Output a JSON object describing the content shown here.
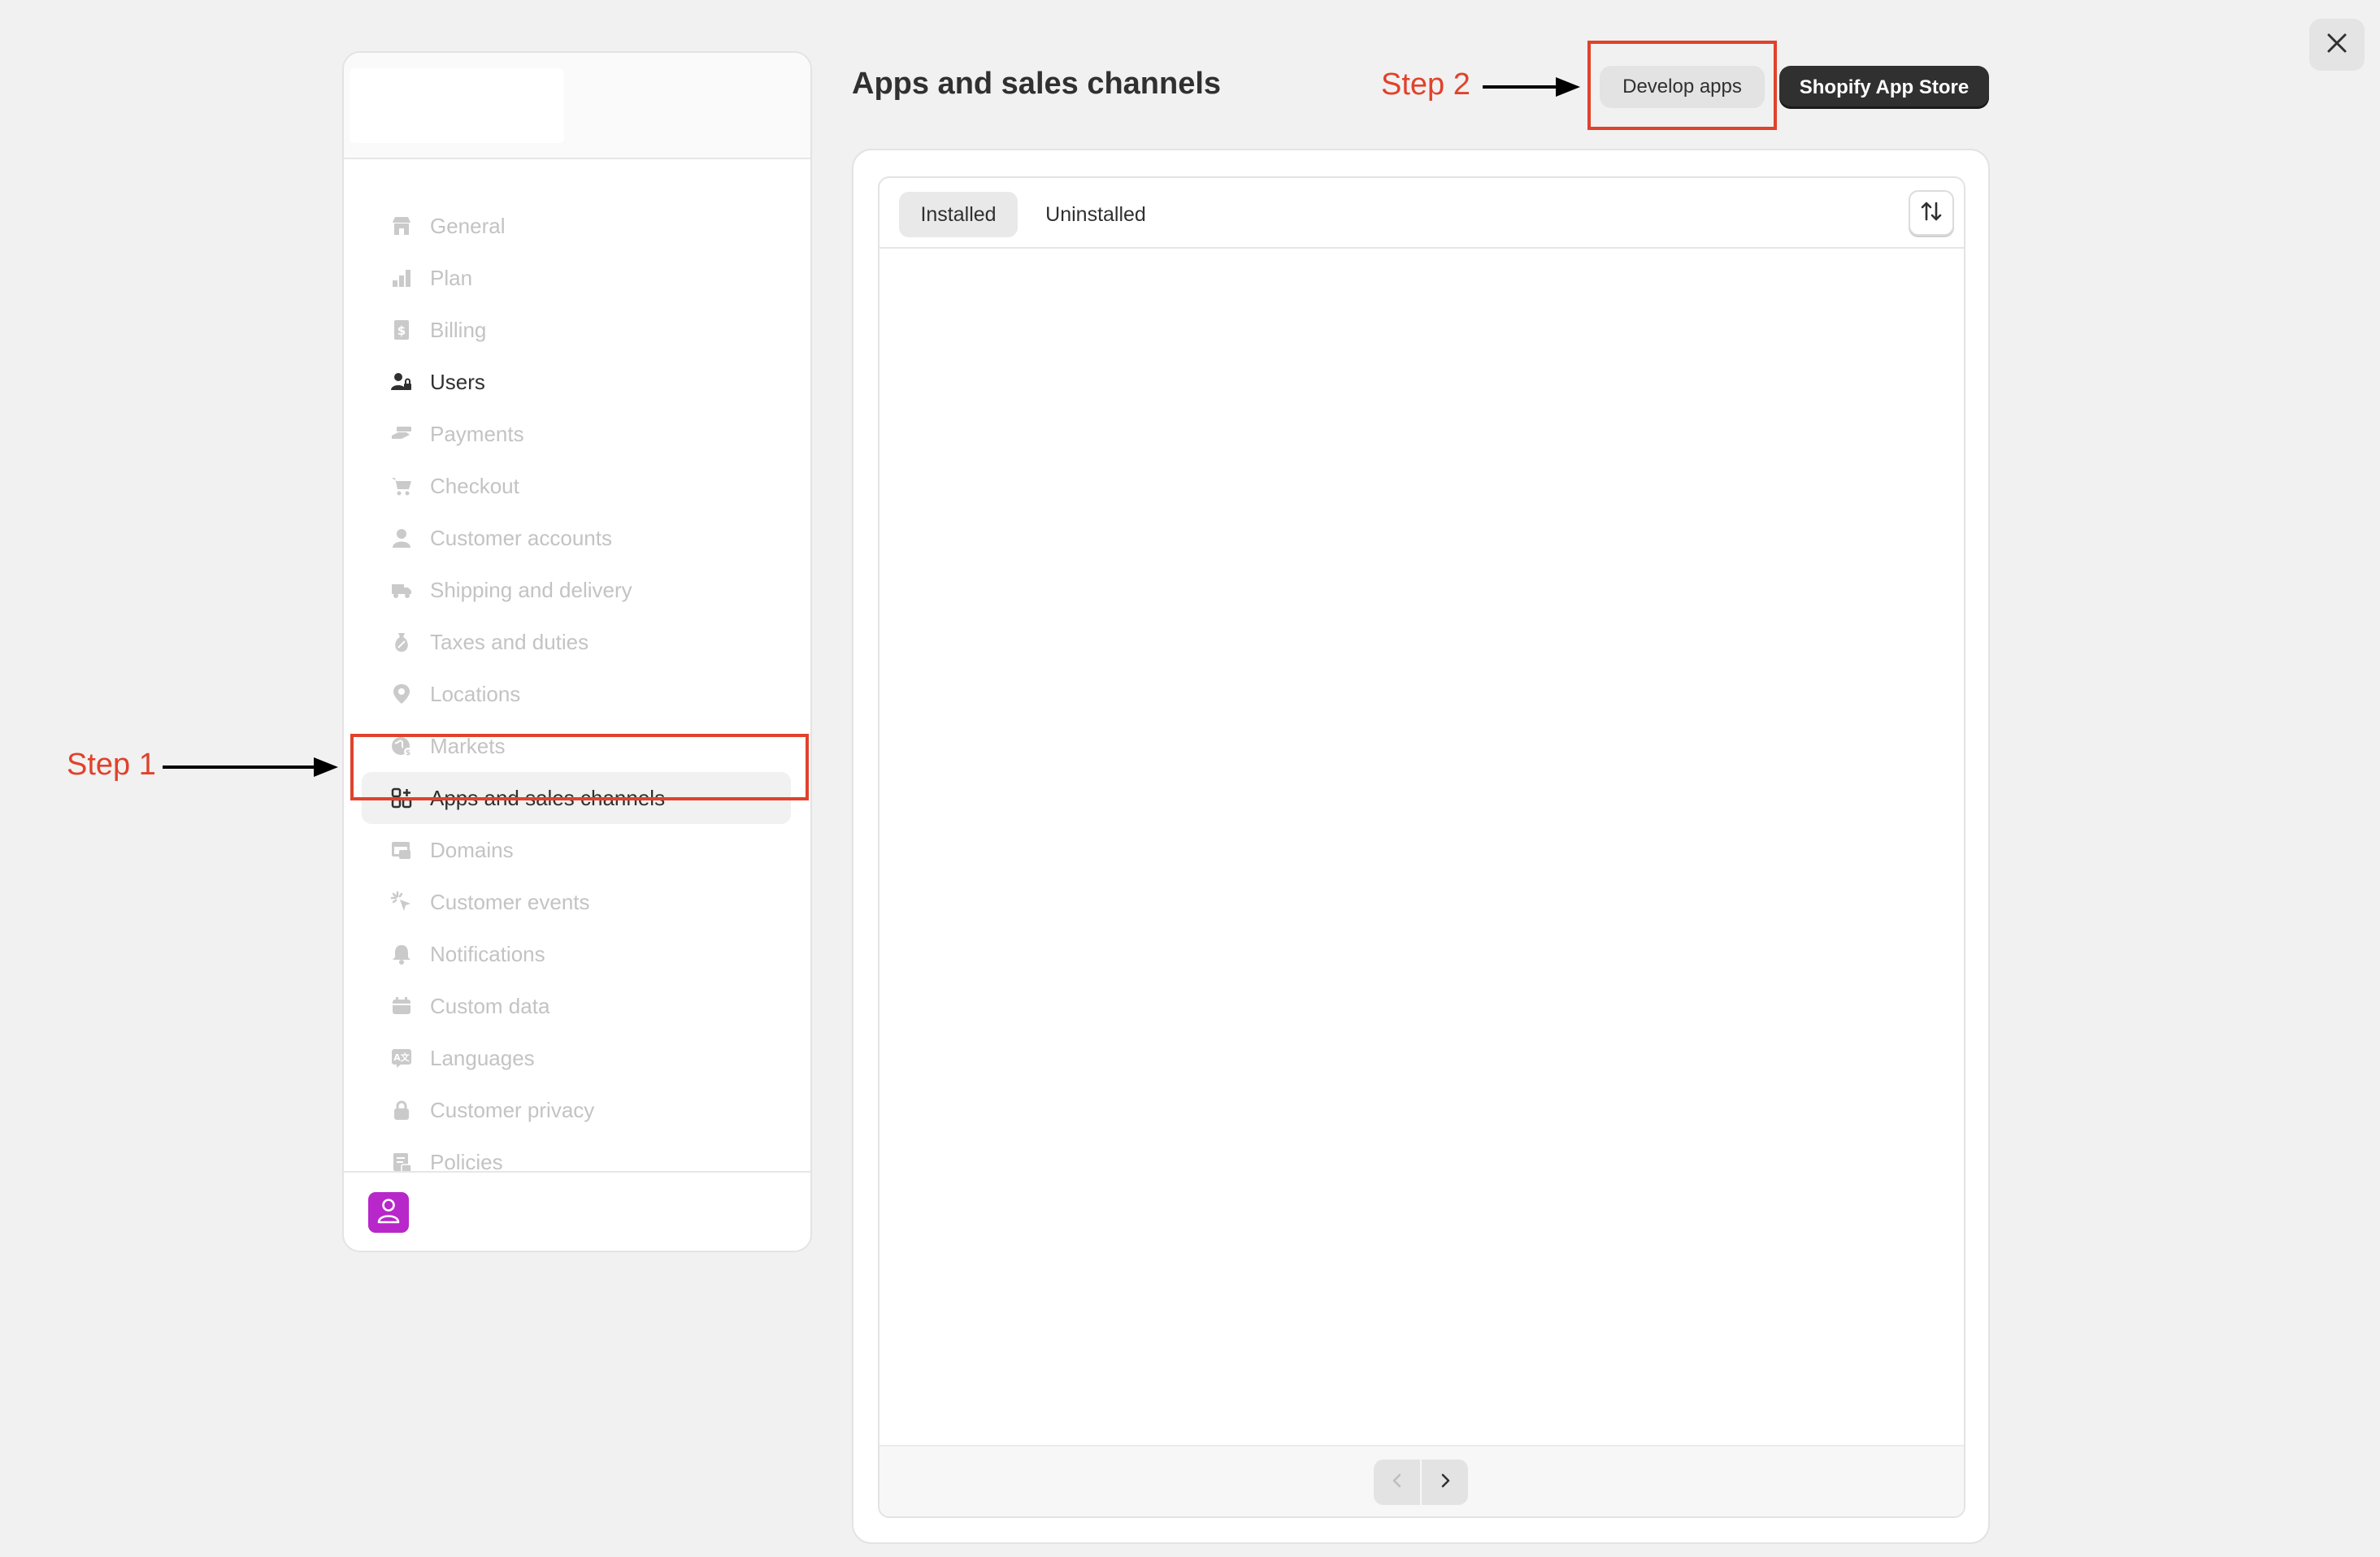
{
  "window": {
    "close_icon": "close-icon"
  },
  "sidebar": {
    "items": [
      {
        "label": "General",
        "icon": "store-icon",
        "state": "disabled"
      },
      {
        "label": "Plan",
        "icon": "plan-icon",
        "state": "disabled"
      },
      {
        "label": "Billing",
        "icon": "billing-icon",
        "state": "disabled"
      },
      {
        "label": "Users",
        "icon": "users-icon",
        "state": "normal"
      },
      {
        "label": "Payments",
        "icon": "payments-icon",
        "state": "disabled"
      },
      {
        "label": "Checkout",
        "icon": "cart-icon",
        "state": "disabled"
      },
      {
        "label": "Customer accounts",
        "icon": "person-icon",
        "state": "disabled"
      },
      {
        "label": "Shipping and delivery",
        "icon": "truck-icon",
        "state": "disabled"
      },
      {
        "label": "Taxes and duties",
        "icon": "tax-icon",
        "state": "disabled"
      },
      {
        "label": "Locations",
        "icon": "location-icon",
        "state": "disabled"
      },
      {
        "label": "Markets",
        "icon": "globe-icon",
        "state": "disabled"
      },
      {
        "label": "Apps and sales channels",
        "icon": "apps-icon",
        "state": "active"
      },
      {
        "label": "Domains",
        "icon": "domains-icon",
        "state": "disabled"
      },
      {
        "label": "Customer events",
        "icon": "cursor-icon",
        "state": "disabled"
      },
      {
        "label": "Notifications",
        "icon": "bell-icon",
        "state": "disabled"
      },
      {
        "label": "Custom data",
        "icon": "database-icon",
        "state": "disabled"
      },
      {
        "label": "Languages",
        "icon": "language-icon",
        "state": "disabled"
      },
      {
        "label": "Customer privacy",
        "icon": "lock-icon",
        "state": "disabled"
      },
      {
        "label": "Policies",
        "icon": "policy-icon",
        "state": "disabled"
      }
    ],
    "footer": {
      "avatar_icon": "avatar-icon",
      "avatar_color": "#b727c9"
    }
  },
  "header": {
    "title": "Apps and sales channels",
    "develop_apps_label": "Develop apps",
    "app_store_label": "Shopify App Store"
  },
  "tabs": [
    {
      "label": "Installed",
      "selected": true
    },
    {
      "label": "Uninstalled",
      "selected": false
    }
  ],
  "annotations": {
    "step1": "Step 1",
    "step2": "Step 2",
    "color": "#e0422b"
  }
}
